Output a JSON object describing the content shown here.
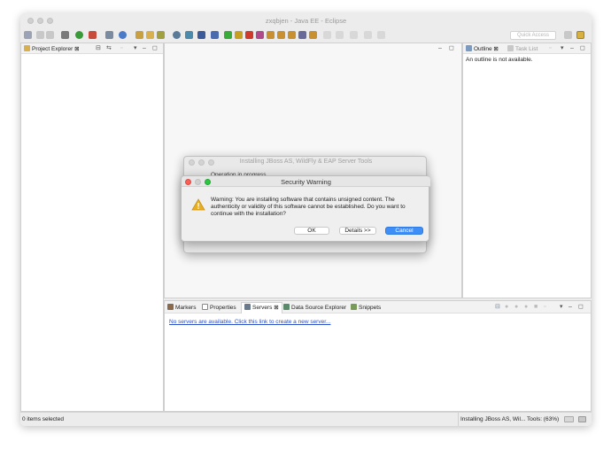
{
  "window": {
    "title": "zxqbjen - Java EE - Eclipse"
  },
  "toolbar": {
    "quick_access_placeholder": "Quick Access"
  },
  "project_explorer": {
    "tab_label": "Project Explorer"
  },
  "outline": {
    "tab_label": "Outline",
    "task_list_label": "Task List",
    "empty_message": "An outline is not available."
  },
  "bottom_panel": {
    "tabs": [
      {
        "label": "Markers"
      },
      {
        "label": "Properties"
      },
      {
        "label": "Servers"
      },
      {
        "label": "Data Source Explorer"
      },
      {
        "label": "Snippets"
      }
    ],
    "servers_link": "No servers are available. Click this link to create a new server..."
  },
  "status": {
    "left": "0 items selected",
    "right": "Installing JBoss AS, Wil... Tools: (63%)"
  },
  "install_dialog": {
    "title": "Installing JBoss AS, WildFly & EAP Server Tools",
    "operation": "Operation in progress..."
  },
  "security_dialog": {
    "title": "Security Warning",
    "message": "Warning: You are installing software that contains unsigned content. The authenticity or validity of this software cannot be established. Do you want to continue with the installation?",
    "ok_label": "OK",
    "details_label": "Details >>",
    "cancel_label": "Cancel"
  },
  "colors": {
    "accent": "#3d8ef7",
    "link": "#2a4fc7",
    "warning": "#e8b020"
  }
}
